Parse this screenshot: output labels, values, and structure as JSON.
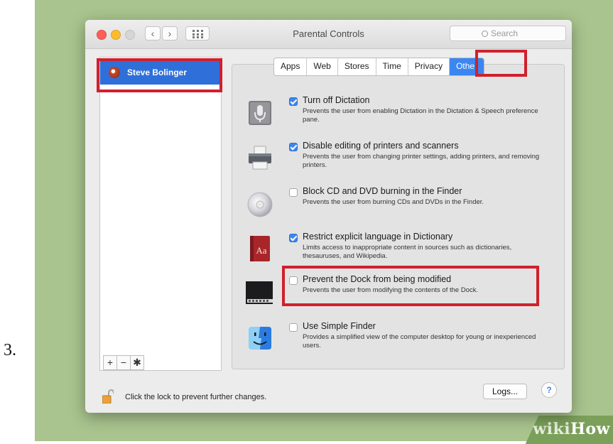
{
  "step": {
    "number": "3."
  },
  "window": {
    "title": "Parental Controls",
    "search_placeholder": "Search"
  },
  "sidebar": {
    "user_name": "Steve Bolinger",
    "plus": "+",
    "minus": "−",
    "gear": "✱"
  },
  "tabs": [
    {
      "label": "Apps",
      "active": false
    },
    {
      "label": "Web",
      "active": false
    },
    {
      "label": "Stores",
      "active": false
    },
    {
      "label": "Time",
      "active": false
    },
    {
      "label": "Privacy",
      "active": false
    },
    {
      "label": "Other",
      "active": true
    }
  ],
  "options": [
    {
      "icon": "microphone-icon",
      "checked": true,
      "title": "Turn off Dictation",
      "desc": "Prevents the user from enabling Dictation in the Dictation & Speech preference pane."
    },
    {
      "icon": "printer-icon",
      "checked": true,
      "title": "Disable editing of printers and scanners",
      "desc": "Prevents the user from changing printer settings, adding printers, and removing printers."
    },
    {
      "icon": "cd-icon",
      "checked": false,
      "title": "Block CD and DVD burning in the Finder",
      "desc": "Prevents the user from burning CDs and DVDs in the Finder."
    },
    {
      "icon": "dictionary-icon",
      "checked": true,
      "title": "Restrict explicit language in Dictionary",
      "desc": "Limits access to inappropriate content in sources such as dictionaries, thesauruses, and Wikipedia."
    },
    {
      "icon": "dock-icon",
      "checked": false,
      "title": "Prevent the Dock from being modified",
      "desc": "Prevents the user from modifying the contents of the Dock."
    },
    {
      "icon": "finder-icon",
      "checked": false,
      "title": "Use Simple Finder",
      "desc": "Provides a simplified view of the computer desktop for young or inexperienced users."
    }
  ],
  "footer": {
    "lock_text": "Click the lock to prevent further changes.",
    "logs_label": "Logs...",
    "help_label": "?"
  },
  "watermark": {
    "part1": "wiki",
    "part2": "How"
  },
  "colors": {
    "highlight": "#d0202d",
    "accent": "#3b86f0",
    "background": "#a9c48e"
  }
}
